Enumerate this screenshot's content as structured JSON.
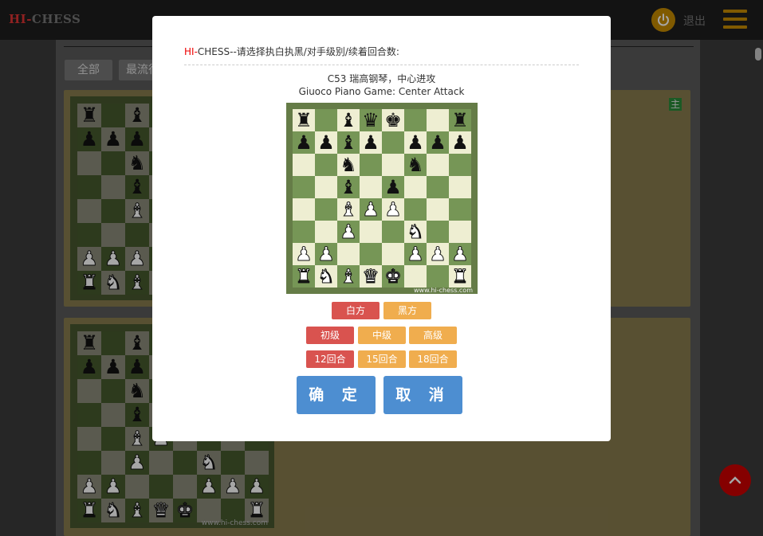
{
  "header": {
    "logo_hi": "HI-",
    "logo_rest": "CHESS",
    "logout_label": "退出"
  },
  "filters": [
    "全部",
    "最流行"
  ],
  "card_badge": "主",
  "watermark": "www.hi-chess.com",
  "modal": {
    "title_hi": "HI-",
    "title_rest": "CHESS--请选择执白执黑/对手级别/续着回合数:",
    "opening_code": "C53 瑞高钢琴，中心进攻",
    "opening_en": "Giuoco Piano Game: Center Attack",
    "side_options": [
      "白方",
      "黑方"
    ],
    "side_selected": 0,
    "level_options": [
      "初级",
      "中级",
      "高级"
    ],
    "level_selected": 0,
    "round_options": [
      "12回合",
      "15回合",
      "18回合"
    ],
    "round_selected": 0,
    "confirm_label": "确 定",
    "cancel_label": "取 消"
  },
  "colors": {
    "accent_red": "#d9534f",
    "accent_orange": "#f0ad4e",
    "primary_blue": "#4d8ed1",
    "board_light": "#eeeed2",
    "board_dark": "#769656"
  },
  "position": [
    "r . b q k . . r",
    "p p b p . p p p",
    ". . n . . n . .",
    ". . b . p . . .",
    ". . B P P . . .",
    ". . P . . N . .",
    "P P . . . P P P",
    "R N B Q K . . R"
  ],
  "mini_position": [
    "r . b . . . . .",
    "p p p . . . . .",
    ". . n . . . . .",
    ". . b . . . . .",
    ". . B . . . . .",
    ". . . . . . . .",
    "P P P . . . . .",
    "R N B . . . . ."
  ],
  "mini_position_2": [
    "r . b . . . . .",
    "p p p . . . . .",
    ". . n . . . . .",
    ". . b . . . . .",
    ". . B P . . . .",
    ". . P . . N . .",
    "P P . . . P P P",
    "R N B Q K . . R"
  ]
}
